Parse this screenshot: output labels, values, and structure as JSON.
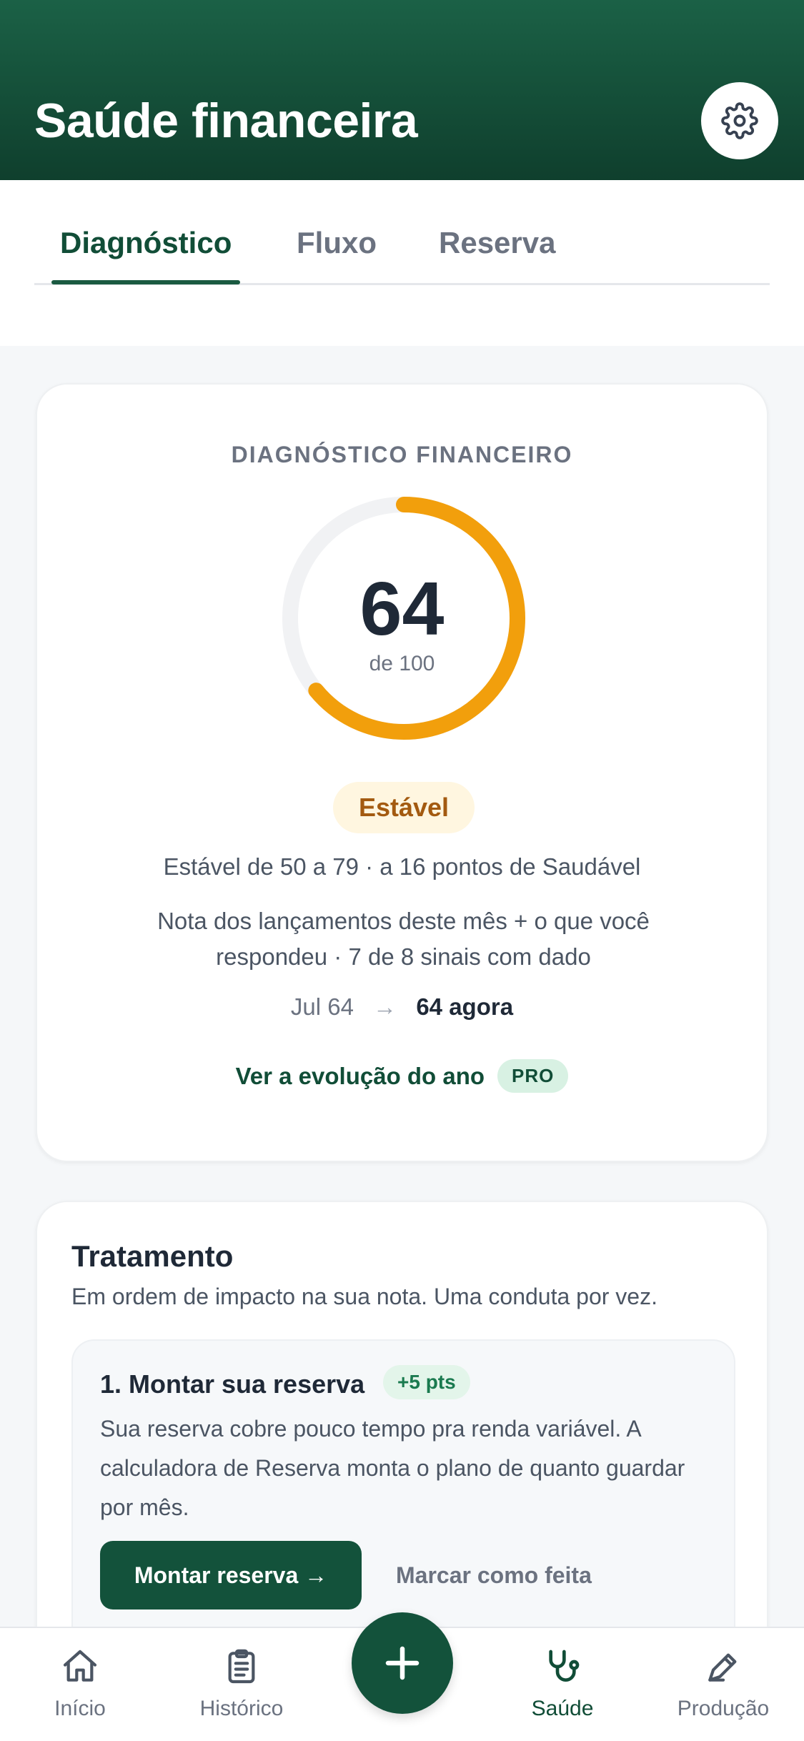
{
  "header": {
    "title": "Saúde financeira",
    "settings_icon": "gear-icon"
  },
  "tabs": [
    {
      "label": "Diagnóstico",
      "active": true
    },
    {
      "label": "Fluxo",
      "active": false
    },
    {
      "label": "Reserva",
      "active": false
    }
  ],
  "diagnostic": {
    "title": "DIAGNÓSTICO FINANCEIRO",
    "score": 64,
    "score_display": "64",
    "max_label": "de 100",
    "status": "Estável",
    "range_text": "Estável de 50 a 79 · a 16 pontos de Saudável",
    "note": "Nota dos lançamentos deste mês + o que você respondeu · 7 de 8 sinais com dado",
    "history_prev": "Jul 64",
    "history_arrow": "→",
    "history_now": "64 agora",
    "evolution_link": "Ver a evolução do ano",
    "pro_badge": "PRO",
    "colors": {
      "gauge_track": "#f1f2f4",
      "gauge_fill": "#f29f0c"
    }
  },
  "treatment": {
    "title": "Tratamento",
    "subtitle": "Em ordem de impacto na sua nota. Uma conduta por vez.",
    "action": {
      "title": "1. Montar sua reserva",
      "points": "+5 pts",
      "description": "Sua reserva cobre pouco tempo pra renda variável. A calculadora de Reserva monta o plano de quanto guardar por mês.",
      "primary": "Montar reserva →",
      "secondary": "Marcar como feita"
    }
  },
  "nav": [
    {
      "label": "Início",
      "icon": "home-icon",
      "active": false
    },
    {
      "label": "Histórico",
      "icon": "clipboard-icon",
      "active": false
    },
    {
      "label": "Saúde",
      "icon": "stethoscope-icon",
      "active": true
    },
    {
      "label": "Produção",
      "icon": "pen-icon",
      "active": false
    }
  ],
  "fab": {
    "icon": "plus-icon"
  },
  "colors": {
    "primary": "#13523b",
    "accent": "#f29f0c",
    "header_top": "#1b6146",
    "header_bottom": "#0f3f2d"
  }
}
